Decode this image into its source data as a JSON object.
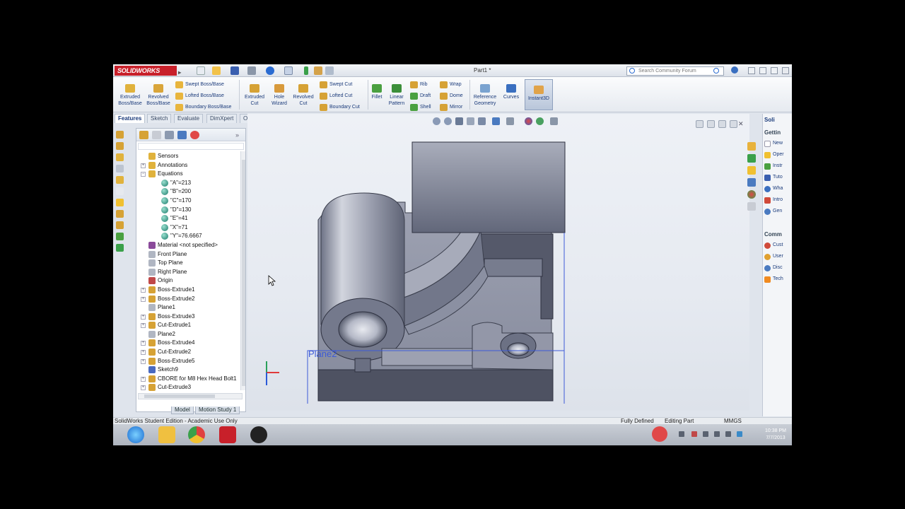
{
  "app": {
    "logo_text": "SOLIDWORKS",
    "document_title": "Part1 *",
    "search_placeholder": "Search Community Forum"
  },
  "commands": {
    "extruded_boss": "Extruded Boss/Base",
    "revolved_boss": "Revolved Boss/Base",
    "swept_boss": "Swept Boss/Base",
    "lofted_boss": "Lofted Boss/Base",
    "boundary_boss": "Boundary Boss/Base",
    "extruded_cut": "Extruded Cut",
    "hole_wizard": "Hole Wizard",
    "revolved_cut": "Revolved Cut",
    "swept_cut": "Swept Cut",
    "lofted_cut": "Lofted Cut",
    "boundary_cut": "Boundary Cut",
    "fillet": "Fillet",
    "linear_pattern": "Linear Pattern",
    "rib": "Rib",
    "draft": "Draft",
    "shell": "Shell",
    "wrap": "Wrap",
    "dome": "Dome",
    "mirror": "Mirror",
    "reference_geometry": "Reference Geometry",
    "curves": "Curves",
    "instant3d": "Instant3D"
  },
  "tabs": [
    "Features",
    "Sketch",
    "Evaluate",
    "DimXpert",
    "Office Products"
  ],
  "tree": [
    {
      "label": "Sensors",
      "icon": "sensor-icon",
      "expand": "",
      "indent": 0
    },
    {
      "label": "Annotations",
      "icon": "annotation-icon",
      "expand": "+",
      "indent": 0
    },
    {
      "label": "Equations",
      "icon": "equations-icon",
      "expand": "−",
      "indent": 0
    },
    {
      "label": "\"A\"=213",
      "icon": "equation-icon",
      "expand": "",
      "indent": 1
    },
    {
      "label": "\"B\"=200",
      "icon": "equation-icon",
      "expand": "",
      "indent": 1
    },
    {
      "label": "\"C\"=170",
      "icon": "equation-icon",
      "expand": "",
      "indent": 1
    },
    {
      "label": "\"D\"=130",
      "icon": "equation-icon",
      "expand": "",
      "indent": 1
    },
    {
      "label": "\"E\"=41",
      "icon": "equation-icon",
      "expand": "",
      "indent": 1
    },
    {
      "label": "\"X\"=71",
      "icon": "equation-icon",
      "expand": "",
      "indent": 1
    },
    {
      "label": "\"Y\"=76.6667",
      "icon": "equation-icon",
      "expand": "",
      "indent": 1
    },
    {
      "label": "Material <not specified>",
      "icon": "material-icon",
      "expand": "",
      "indent": 0
    },
    {
      "label": "Front Plane",
      "icon": "plane-icon",
      "expand": "",
      "indent": 0
    },
    {
      "label": "Top Plane",
      "icon": "plane-icon",
      "expand": "",
      "indent": 0
    },
    {
      "label": "Right Plane",
      "icon": "plane-icon",
      "expand": "",
      "indent": 0
    },
    {
      "label": "Origin",
      "icon": "origin-icon",
      "expand": "",
      "indent": 0
    },
    {
      "label": "Boss-Extrude1",
      "icon": "feature-icon",
      "expand": "+",
      "indent": 0
    },
    {
      "label": "Boss-Extrude2",
      "icon": "feature-icon",
      "expand": "+",
      "indent": 0
    },
    {
      "label": "Plane1",
      "icon": "plane-icon",
      "expand": "",
      "indent": 0
    },
    {
      "label": "Boss-Extrude3",
      "icon": "feature-icon",
      "expand": "+",
      "indent": 0
    },
    {
      "label": "Cut-Extrude1",
      "icon": "feature-icon",
      "expand": "+",
      "indent": 0
    },
    {
      "label": "Plane2",
      "icon": "plane-icon",
      "expand": "",
      "indent": 0
    },
    {
      "label": "Boss-Extrude4",
      "icon": "feature-icon",
      "expand": "+",
      "indent": 0
    },
    {
      "label": "Cut-Extrude2",
      "icon": "feature-icon",
      "expand": "+",
      "indent": 0
    },
    {
      "label": "Boss-Extrude5",
      "icon": "feature-icon",
      "expand": "+",
      "indent": 0
    },
    {
      "label": "Sketch9",
      "icon": "sketch-icon",
      "expand": "",
      "indent": 0
    },
    {
      "label": "CBORE for M8 Hex Head Bolt1",
      "icon": "hole-icon",
      "expand": "+",
      "indent": 0
    },
    {
      "label": "Cut-Extrude3",
      "icon": "feature-icon",
      "expand": "+",
      "indent": 0
    }
  ],
  "bottom_tabs": [
    "Model",
    "Motion Study 1"
  ],
  "viewport": {
    "plane_label": "Plane2"
  },
  "taskpane": {
    "head1": "Gettin",
    "items1": [
      {
        "label": "New",
        "icon": "new-doc-icon"
      },
      {
        "label": "Oper",
        "icon": "open-icon"
      },
      {
        "label": "Instr",
        "icon": "instructor-icon"
      },
      {
        "label": "Tuto",
        "icon": "tutorial-icon"
      },
      {
        "label": "Wha",
        "icon": "whats-new-icon"
      },
      {
        "label": "Intro",
        "icon": "intro-icon"
      },
      {
        "label": "Gen",
        "icon": "general-icon"
      }
    ],
    "head2": "Comm",
    "items2": [
      {
        "label": "Cust",
        "icon": "customer-icon"
      },
      {
        "label": "User",
        "icon": "user-group-icon"
      },
      {
        "label": "Disc",
        "icon": "discussion-icon"
      },
      {
        "label": "Tech",
        "icon": "rss-icon"
      }
    ],
    "panel_title": "Soli"
  },
  "status": {
    "left": "SolidWorks Student Edition - Academic Use Only",
    "defined": "Fully Defined",
    "mode": "Editing Part",
    "units": "MMGS"
  },
  "clock": {
    "time": "10:38 PM",
    "date": "7/7/2013"
  },
  "colors": {
    "accent_red": "#c8202a",
    "plane_blue": "#3c5ad8",
    "part_gray": "#8e93a4"
  }
}
